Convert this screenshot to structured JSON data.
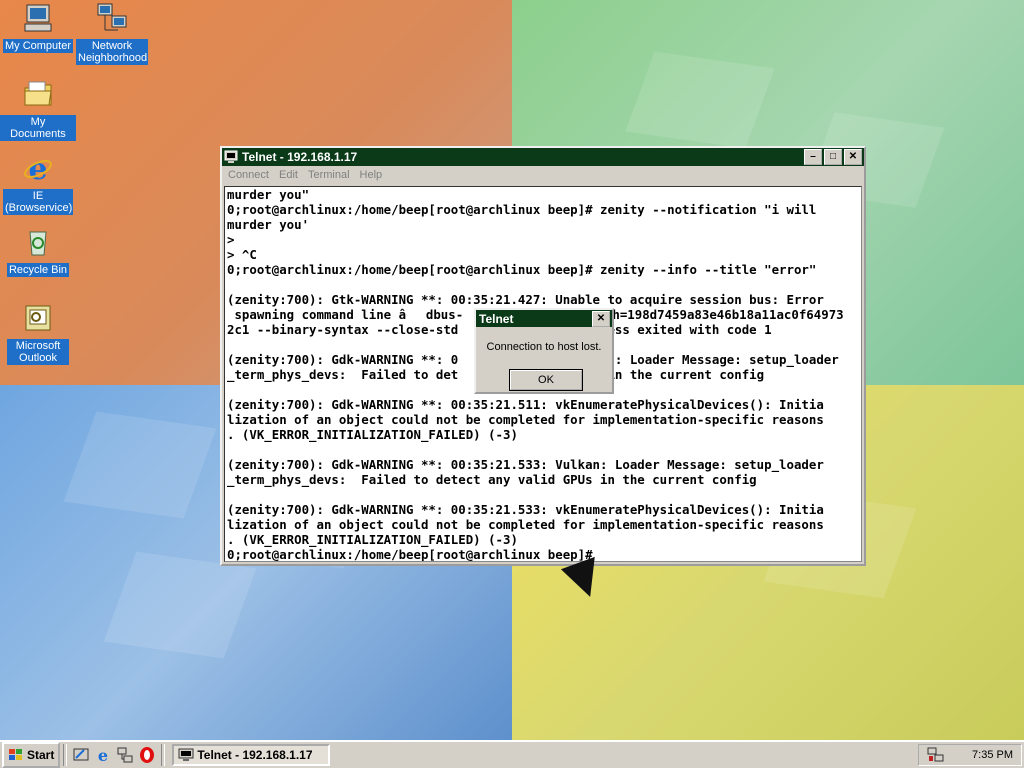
{
  "desktop": {
    "icons": [
      {
        "label": "My Computer",
        "icon": "computer-icon"
      },
      {
        "label": "Network Neighborhood",
        "icon": "network-icon"
      },
      {
        "label": "My Documents",
        "icon": "folder-icon"
      },
      {
        "label": "IE (Browservice)",
        "icon": "ie-icon"
      },
      {
        "label": "Recycle Bin",
        "icon": "recycle-bin-icon"
      },
      {
        "label": "Microsoft Outlook",
        "icon": "outlook-icon"
      }
    ]
  },
  "window": {
    "title": "Telnet - 192.168.1.17",
    "menu": [
      "Connect",
      "Edit",
      "Terminal",
      "Help"
    ],
    "terminal_lines": [
      "murder you\"",
      "0;root@archlinux:/home/beep[root@archlinux beep]# zenity --notification \"i will",
      "murder you'",
      ">",
      "> ^C",
      "0;root@archlinux:/home/beep[root@archlinux beep]# zenity --info --title \"error\"",
      "",
      "(zenity:700): Gtk-WARNING **: 00:35:21.427: Unable to acquire session bus: Error",
      " spawning command line âdbus-                    h=198d7459a83e46b18a11ac0f64973",
      "2c1 --binary-syntax --close-std                    ess exited with code 1",
      "",
      "(zenity:700): Gdk-WARNING **: 0                    n: Loader Message: setup_loader",
      "_term_phys_devs:  Failed to det                    in the current config",
      "",
      "(zenity:700): Gdk-WARNING **: 00:35:21.511: vkEnumeratePhysicalDevices(): Initia",
      "lization of an object could not be completed for implementation-specific reasons",
      ". (VK_ERROR_INITIALIZATION_FAILED) (-3)",
      "",
      "(zenity:700): Gdk-WARNING **: 00:35:21.533: Vulkan: Loader Message: setup_loader",
      "_term_phys_devs:  Failed to detect any valid GPUs in the current config",
      "",
      "(zenity:700): Gdk-WARNING **: 00:35:21.533: vkEnumeratePhysicalDevices(): Initia",
      "lization of an object could not be completed for implementation-specific reasons",
      ". (VK_ERROR_INITIALIZATION_FAILED) (-3)",
      "0;root@archlinux:/home/beep[root@archlinux beep]#"
    ]
  },
  "dialog": {
    "title": "Telnet",
    "message": "Connection to host lost.",
    "ok_label": "OK"
  },
  "taskbar": {
    "start_label": "Start",
    "task_label": "Telnet - 192.168.1.17",
    "clock": "7:35 PM"
  },
  "colors": {
    "titlebar": "#0a3a18",
    "desktop_label_bg": "#1f6fc8"
  }
}
